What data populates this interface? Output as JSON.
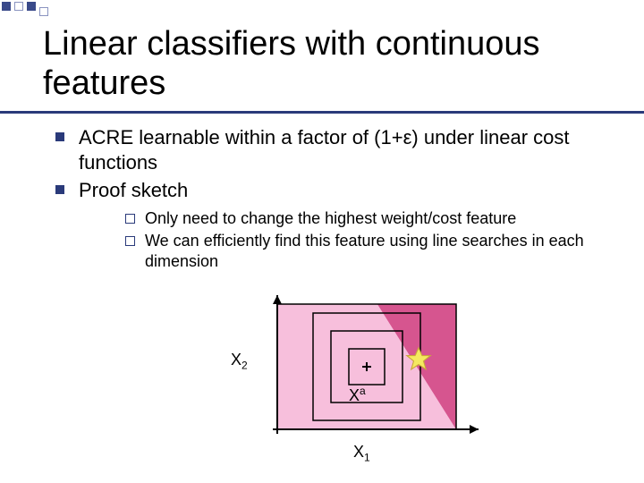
{
  "title": "Linear classifiers with continuous features",
  "bullets": {
    "b1_pre": "ACRE learnable within a factor of (1+",
    "b1_eps": "ε",
    "b1_post": ") under linear cost functions",
    "b2": "Proof sketch"
  },
  "subbullets": {
    "s1": "Only need to change the highest weight/cost feature",
    "s2": "We can efficiently find this feature using line searches in each dimension"
  },
  "axis": {
    "x1": "X",
    "x1_sub": "1",
    "x2": "X",
    "x2_sub": "2",
    "xa": "X",
    "xa_sup": "a"
  },
  "chart_data": {
    "type": "diagram",
    "description": "2D feature space with a linear classifier boundary. Pink region (left of boundary) and dark pink region (right). Center point X^a with three nested concentric squares (cost level sets) around it. A yellow star lies near the classifier boundary, just on the dark-pink side.",
    "axes": {
      "x": "X1",
      "y": "X2"
    },
    "regions": [
      {
        "name": "negative",
        "color": "#f7bfdc",
        "side": "left-of-boundary"
      },
      {
        "name": "positive",
        "color": "#d6558f",
        "side": "right-of-boundary"
      }
    ],
    "boundary": {
      "type": "line",
      "approx_points": [
        [
          0.55,
          1.0
        ],
        [
          1.0,
          0.0
        ]
      ]
    },
    "center_point": {
      "label": "X^a",
      "pos": [
        0.5,
        0.5
      ]
    },
    "level_sets": {
      "shape": "square",
      "count": 3,
      "center": [
        0.5,
        0.5
      ]
    },
    "star": {
      "pos": [
        0.78,
        0.47
      ],
      "color": "#f5e960"
    }
  }
}
